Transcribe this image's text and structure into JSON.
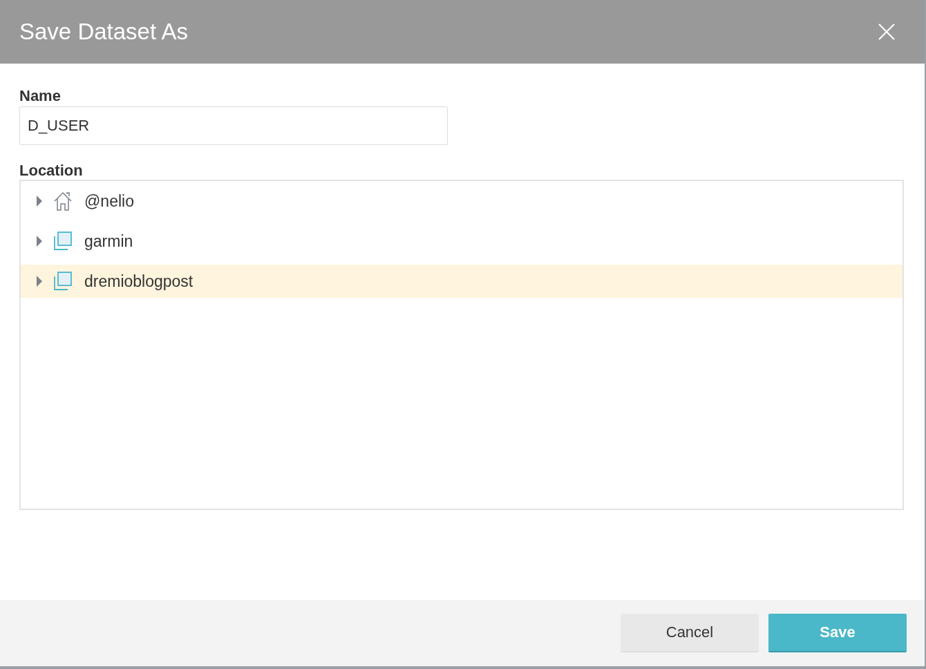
{
  "dialog": {
    "title": "Save Dataset As"
  },
  "name_field": {
    "label": "Name",
    "value": "D_USER"
  },
  "location": {
    "label": "Location",
    "items": [
      {
        "label": "@nelio",
        "kind": "home",
        "expanded": false,
        "selected": false
      },
      {
        "label": "garmin",
        "kind": "space",
        "expanded": false,
        "selected": false
      },
      {
        "label": "dremioblogpost",
        "kind": "space",
        "expanded": false,
        "selected": true
      }
    ]
  },
  "buttons": [
    {
      "label": "Cancel",
      "kind": "secondary"
    },
    {
      "label": "Save",
      "kind": "primary"
    }
  ]
}
